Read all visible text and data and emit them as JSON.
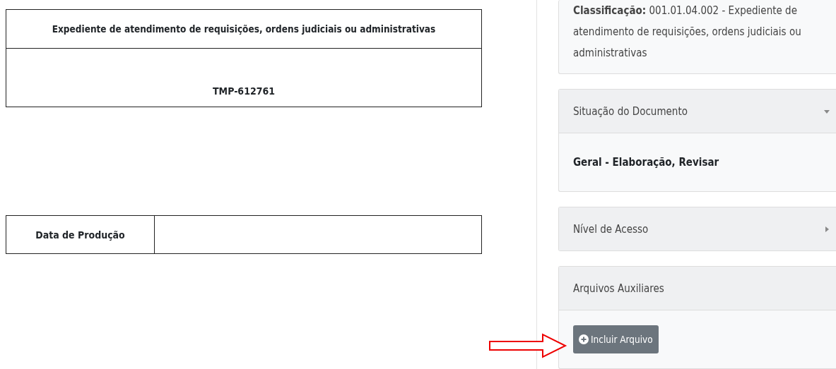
{
  "document": {
    "title": "Expediente de atendimento de requisições, ordens judiciais ou administrativas",
    "code": "TMP-612761",
    "fields": [
      {
        "label": "Data de Produção"
      }
    ]
  },
  "sidebar": {
    "classification": "**Classificação:** 001.01.04.002 - Expediente de atendimento de requisições, ordens judiciais ou administrativas",
    "panels": [
      {
        "kind": "collapsible",
        "title": "Situação do Documento",
        "expanded": true,
        "body": "Geral - Elaboração, Revisar"
      },
      {
        "kind": "collapsible",
        "title": "Nível de Acesso",
        "expanded": false
      },
      {
        "kind": "plain",
        "title": "Arquivos Auxiliares",
        "button": "Incluir Arquivo"
      }
    ]
  }
}
